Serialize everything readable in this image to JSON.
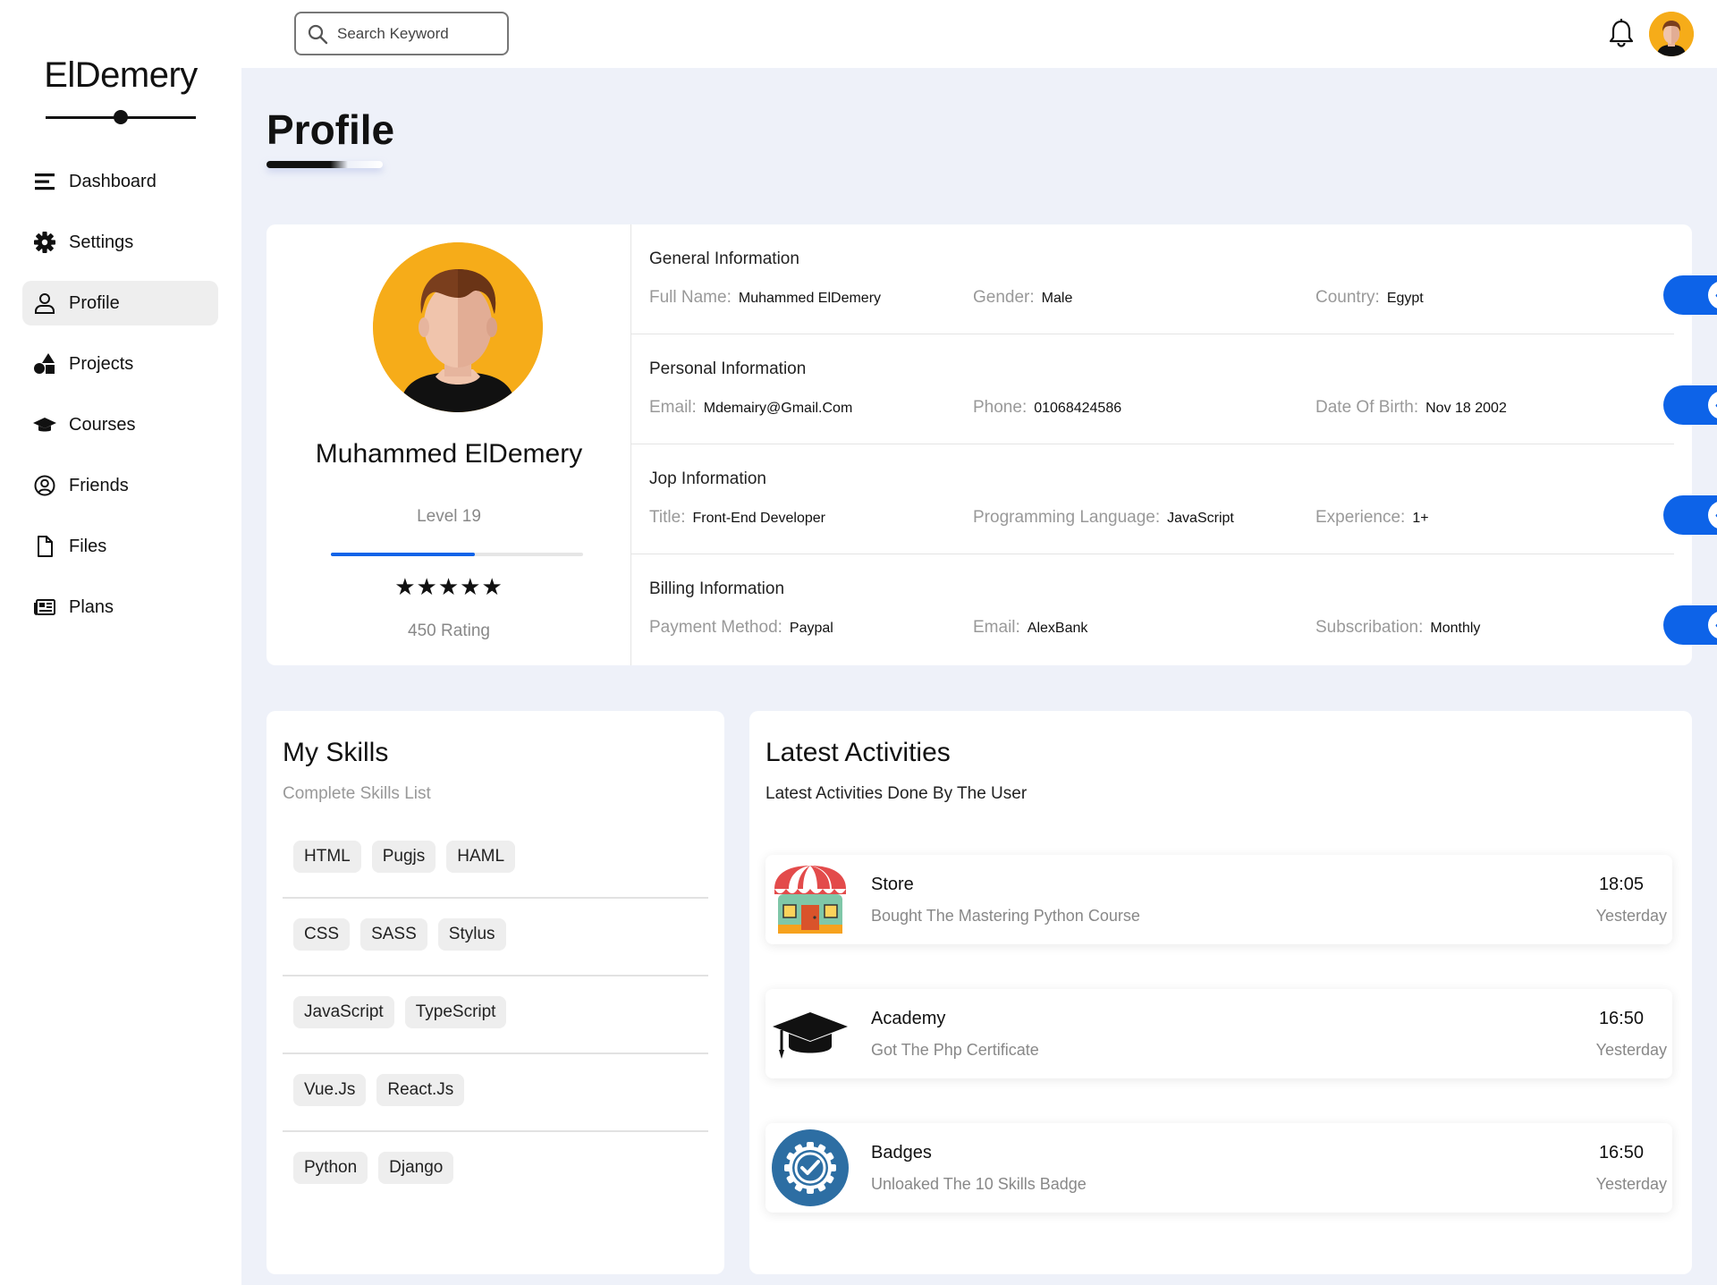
{
  "app": {
    "logo": "ElDemery"
  },
  "sidebar": {
    "items": [
      {
        "label": "Dashboard",
        "icon": "bars-icon"
      },
      {
        "label": "Settings",
        "icon": "gear-icon"
      },
      {
        "label": "Profile",
        "icon": "user-icon",
        "active": true
      },
      {
        "label": "Projects",
        "icon": "shapes-icon"
      },
      {
        "label": "Courses",
        "icon": "graduation-cap-icon"
      },
      {
        "label": "Friends",
        "icon": "user-circle-icon"
      },
      {
        "label": "Files",
        "icon": "file-icon"
      },
      {
        "label": "Plans",
        "icon": "newspaper-icon"
      }
    ]
  },
  "topbar": {
    "search_placeholder": "Search Keyword"
  },
  "page": {
    "title": "Profile"
  },
  "profile": {
    "name": "Muhammed ElDemery",
    "level": "Level 19",
    "level_progress": 0.57,
    "stars": "★★★★★",
    "rating": "450 Rating",
    "sections": [
      {
        "title": "General Information",
        "fields": [
          {
            "label": "Full Name:",
            "value": "Muhammed ElDemery"
          },
          {
            "label": "Gender:",
            "value": "Male"
          },
          {
            "label": "Country:",
            "value": "Egypt"
          }
        ],
        "enabled": true
      },
      {
        "title": "Personal Information",
        "fields": [
          {
            "label": "Email:",
            "value": "Mdemairy@Gmail.Com"
          },
          {
            "label": "Phone:",
            "value": "01068424586"
          },
          {
            "label": "Date Of Birth:",
            "value": "Nov 18 2002"
          }
        ],
        "enabled": true
      },
      {
        "title": "Jop Information",
        "fields": [
          {
            "label": "Title:",
            "value": "Front-End Developer"
          },
          {
            "label": "Programming Language:",
            "value": "JavaScript"
          },
          {
            "label": "Experience:",
            "value": "1+"
          }
        ],
        "enabled": true
      },
      {
        "title": "Billing Information",
        "fields": [
          {
            "label": "Payment Method:",
            "value": "Paypal"
          },
          {
            "label": "Email:",
            "value": "AlexBank"
          },
          {
            "label": "Subscribation:",
            "value": "Monthly"
          }
        ],
        "enabled": true
      }
    ]
  },
  "skills": {
    "title": "My Skills",
    "subtitle": "Complete Skills List",
    "rows": [
      [
        "HTML",
        "Pugjs",
        "HAML"
      ],
      [
        "CSS",
        "SASS",
        "Stylus"
      ],
      [
        "JavaScript",
        "TypeScript"
      ],
      [
        "Vue.Js",
        "React.Js"
      ],
      [
        "Python",
        "Django"
      ]
    ]
  },
  "activities": {
    "title": "Latest Activities",
    "subtitle": "Latest Activities Done By The User",
    "items": [
      {
        "name": "Store",
        "desc": "Bought The Mastering Python Course",
        "time": "18:05",
        "day": "Yesterday",
        "icon": "store-icon"
      },
      {
        "name": "Academy",
        "desc": "Got The Php Certificate",
        "time": "16:50",
        "day": "Yesterday",
        "icon": "graduation-cap-icon"
      },
      {
        "name": "Badges",
        "desc": "Unloaked The 10 Skills Badge",
        "time": "16:50",
        "day": "Yesterday",
        "icon": "badge-icon"
      }
    ]
  },
  "colors": {
    "accent": "#0d63e8",
    "background": "#eef1f9",
    "avatar_bg": "#f6ac19"
  }
}
